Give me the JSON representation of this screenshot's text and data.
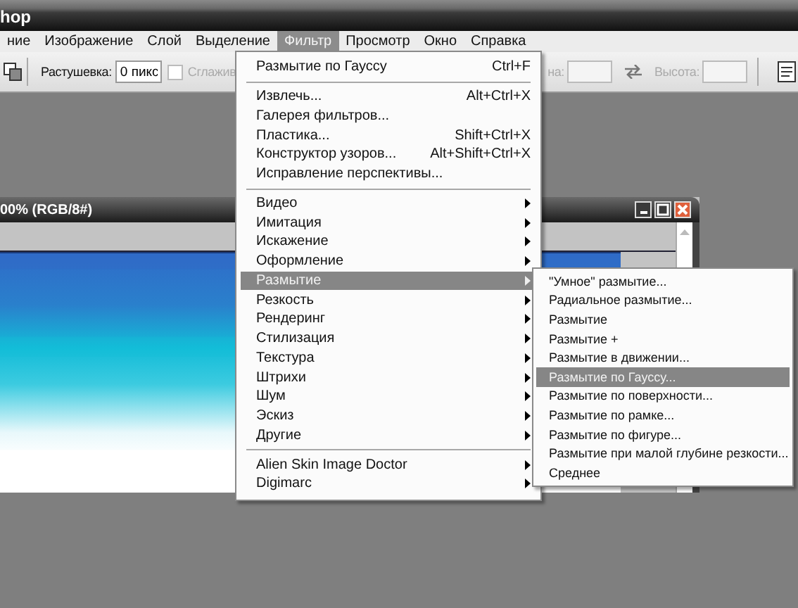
{
  "app_title": "hop",
  "menu_bar": [
    {
      "label": "ние",
      "selected": false
    },
    {
      "label": "Изображение",
      "selected": false
    },
    {
      "label": "Слой",
      "selected": false
    },
    {
      "label": "Выделение",
      "selected": false
    },
    {
      "label": "Фильтр",
      "selected": true
    },
    {
      "label": "Просмотр",
      "selected": false
    },
    {
      "label": "Окно",
      "selected": false
    },
    {
      "label": "Справка",
      "selected": false
    }
  ],
  "options_bar": {
    "feather_label": "Растушевка:",
    "feather_value": "0 пикс",
    "antialias": {
      "label": "Сглажив",
      "checked": false,
      "disabled": true
    },
    "size_fields": [
      {
        "label": "на:",
        "disabled": true
      },
      {
        "label": "Высота:",
        "disabled": true
      }
    ]
  },
  "document": {
    "title": "00% (RGB/8#)"
  },
  "filter_menu": [
    {
      "kind": "command",
      "label": "Размытие по Гауссу",
      "shortcut": "Ctrl+F",
      "selected": false
    },
    {
      "kind": "separator"
    },
    {
      "kind": "command",
      "label": "Извлечь...",
      "shortcut": "Alt+Ctrl+X",
      "selected": false
    },
    {
      "kind": "command",
      "label": "Галерея фильтров...",
      "selected": false
    },
    {
      "kind": "command",
      "label": "Пластика...",
      "shortcut": "Shift+Ctrl+X",
      "selected": false
    },
    {
      "kind": "command",
      "label": "Конструктор узоров...",
      "shortcut": "Alt+Shift+Ctrl+X",
      "selected": false
    },
    {
      "kind": "command",
      "label": "Исправление перспективы...",
      "selected": false
    },
    {
      "kind": "separator"
    },
    {
      "kind": "submenu",
      "label": "Видео",
      "selected": false
    },
    {
      "kind": "submenu",
      "label": "Имитация",
      "selected": false
    },
    {
      "kind": "submenu",
      "label": "Искажение",
      "selected": false
    },
    {
      "kind": "submenu",
      "label": "Оформление",
      "selected": false
    },
    {
      "kind": "submenu",
      "label": "Размытие",
      "selected": true
    },
    {
      "kind": "submenu",
      "label": "Резкость",
      "selected": false
    },
    {
      "kind": "submenu",
      "label": "Рендеринг",
      "selected": false
    },
    {
      "kind": "submenu",
      "label": "Стилизация",
      "selected": false
    },
    {
      "kind": "submenu",
      "label": "Текстура",
      "selected": false
    },
    {
      "kind": "submenu",
      "label": "Штрихи",
      "selected": false
    },
    {
      "kind": "submenu",
      "label": "Шум",
      "selected": false
    },
    {
      "kind": "submenu",
      "label": "Эскиз",
      "selected": false
    },
    {
      "kind": "submenu",
      "label": "Другие",
      "selected": false
    },
    {
      "kind": "separator"
    },
    {
      "kind": "submenu",
      "label": "Alien Skin Image Doctor",
      "selected": false
    },
    {
      "kind": "submenu",
      "label": "Digimarc",
      "selected": false
    }
  ],
  "blur_submenu": [
    {
      "kind": "command",
      "label": "\"Умное\" размытие...",
      "selected": false
    },
    {
      "kind": "command",
      "label": "Радиальное размытие...",
      "selected": false
    },
    {
      "kind": "command",
      "label": "Размытие",
      "selected": false
    },
    {
      "kind": "command",
      "label": "Размытие +",
      "selected": false
    },
    {
      "kind": "command",
      "label": "Размытие в движении...",
      "selected": false
    },
    {
      "kind": "command",
      "label": "Размытие по Гауссу...",
      "selected": true
    },
    {
      "kind": "command",
      "label": "Размытие по поверхности...",
      "selected": false
    },
    {
      "kind": "command",
      "label": "Размытие по рамке...",
      "selected": false
    },
    {
      "kind": "command",
      "label": "Размытие по фигуре...",
      "selected": false
    },
    {
      "kind": "command",
      "label": "Размытие при малой глубине резкости...",
      "selected": false
    },
    {
      "kind": "command",
      "label": "Среднее",
      "selected": false
    }
  ]
}
